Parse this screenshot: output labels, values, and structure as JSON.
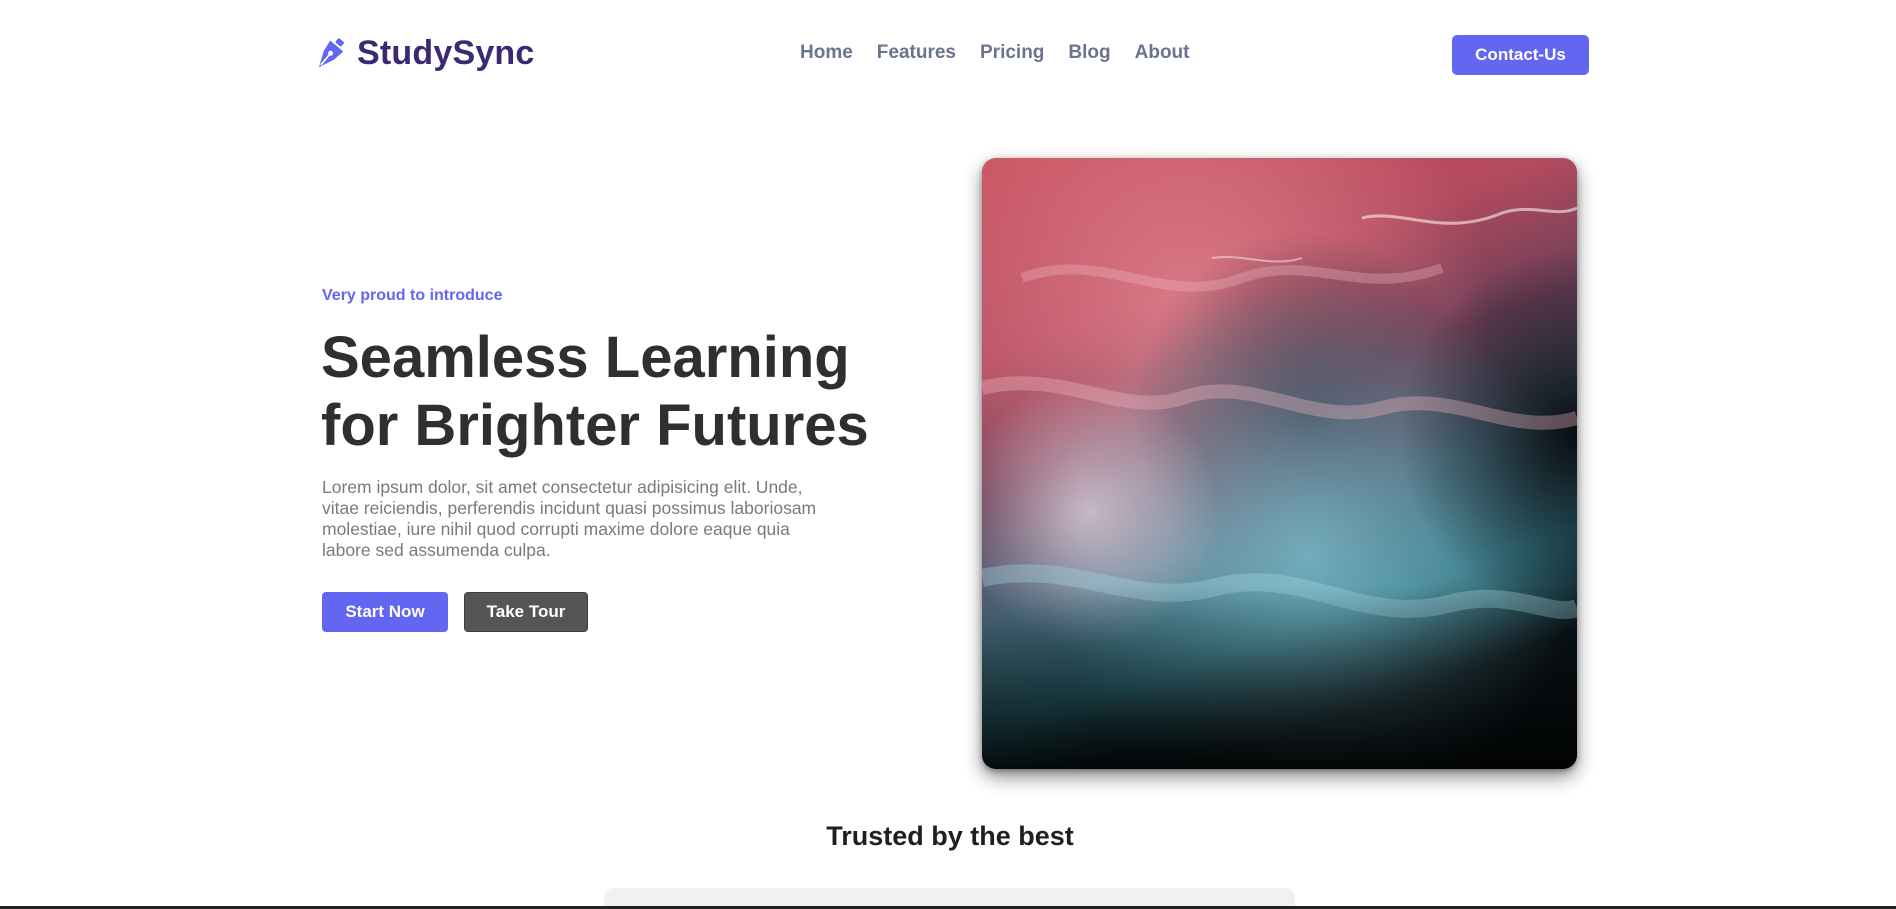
{
  "brand": {
    "name": "StudySync",
    "icon": "fountain-pen-icon",
    "color": "#3b2a73"
  },
  "nav": {
    "items": [
      {
        "label": "Home"
      },
      {
        "label": "Features"
      },
      {
        "label": "Pricing"
      },
      {
        "label": "Blog"
      },
      {
        "label": "About"
      }
    ],
    "cta_label": "Contact-Us"
  },
  "hero": {
    "eyebrow": "Very proud to introduce",
    "title_line1": "Seamless Learning",
    "title_line2": "for Brighter Futures",
    "description": "Lorem ipsum dolor, sit amet consectetur adipisicing elit. Unde, vitae reiciendis, perferendis incidunt quasi possimus laboriosam molestiae, iure nihil quod corrupti maxime dolore eaque quia labore sed assumenda culpa.",
    "primary_button": "Start Now",
    "secondary_button": "Take Tour"
  },
  "trusted": {
    "title": "Trusted by the best"
  },
  "colors": {
    "accent": "#6366f1",
    "heading": "#2f2f2f",
    "nav_text": "#6b7390",
    "secondary_button": "#555555"
  }
}
